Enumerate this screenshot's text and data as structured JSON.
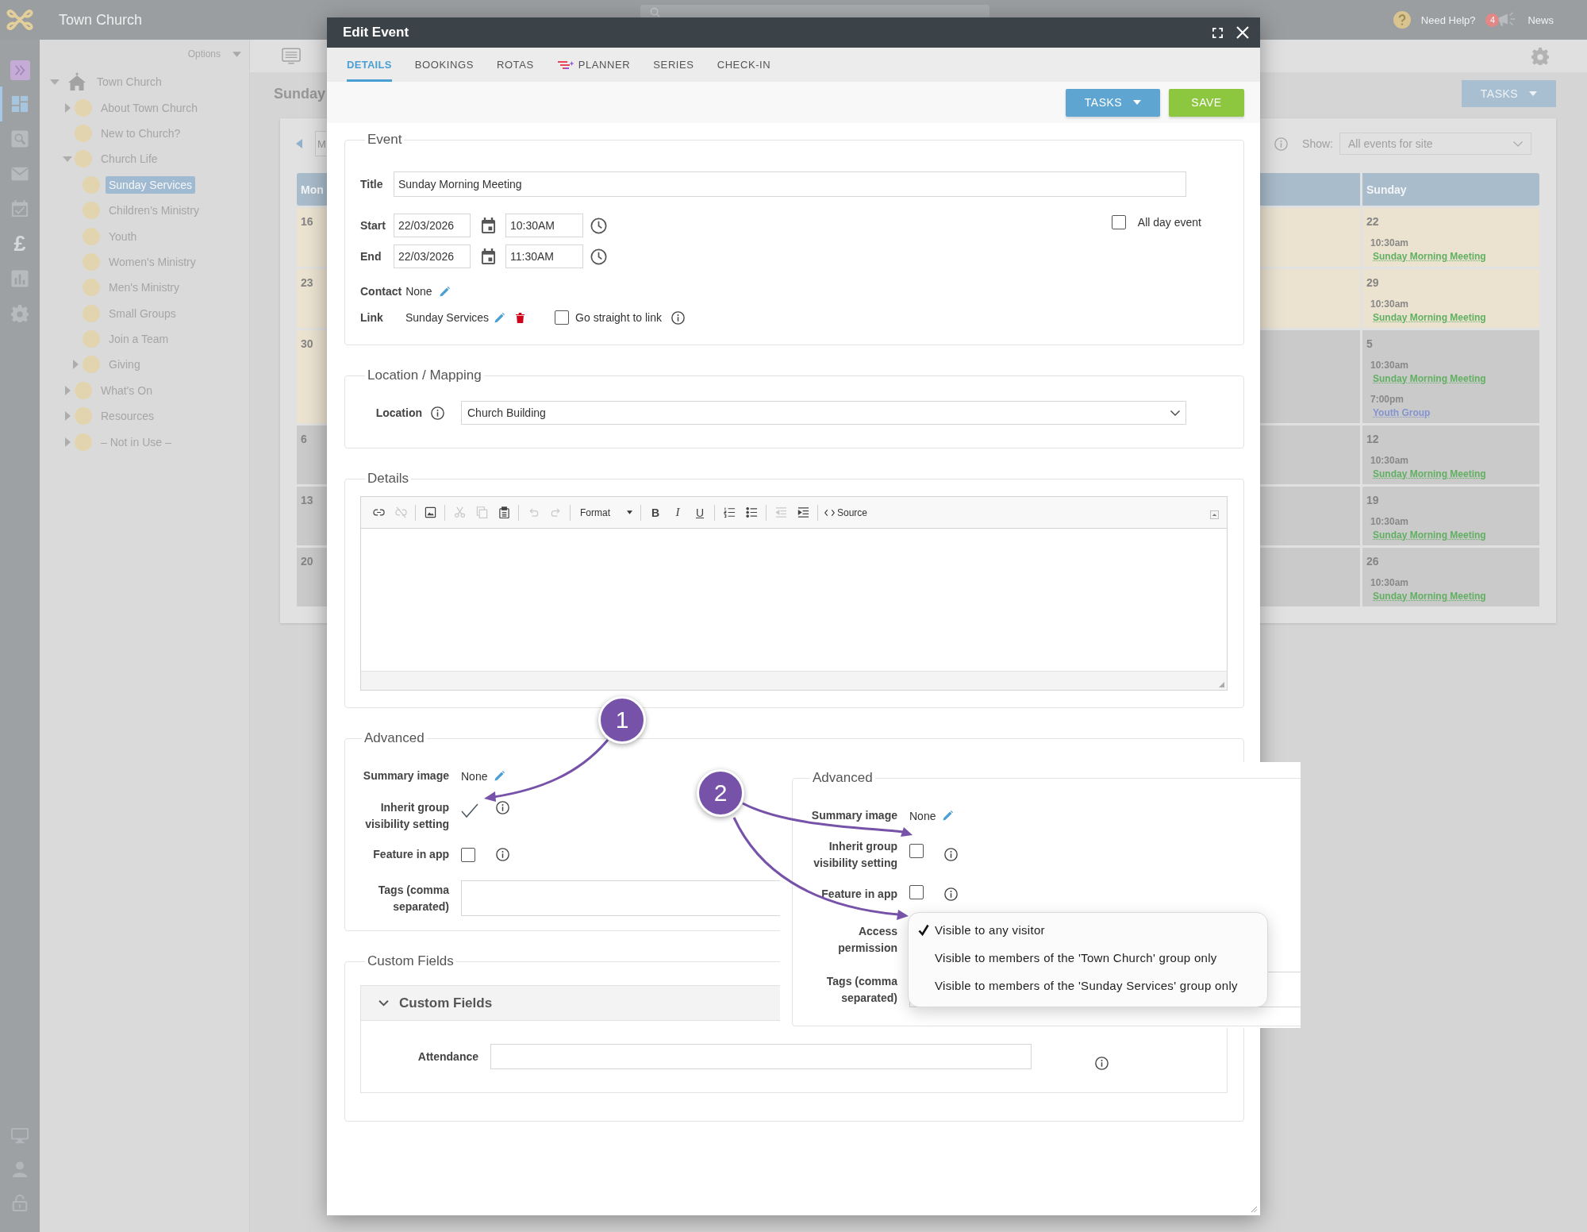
{
  "app_bar": {
    "site_name": "Town Church",
    "help_label": "Need Help?",
    "news_count": "4",
    "news_label": "News"
  },
  "nav_rail": {
    "items": [
      {
        "selected": true
      },
      {
        "selected": false
      },
      {
        "selected": false
      },
      {
        "selected": false
      },
      {
        "selected": false,
        "label": "£"
      },
      {
        "selected": false
      },
      {
        "selected": false
      }
    ]
  },
  "tree": {
    "options_label": "Options",
    "items": [
      {
        "label": "Town Church",
        "kind": "site",
        "expanded": true,
        "selected": false,
        "children": [
          {
            "label": "About Town Church",
            "kind": "page",
            "expanded": false,
            "selected": false
          },
          {
            "label": "New to Church?",
            "kind": "page",
            "selected": false
          },
          {
            "label": "Church Life",
            "kind": "page",
            "expanded": true,
            "selected": false,
            "children": [
              {
                "label": "Sunday Services",
                "kind": "page",
                "selected": true
              },
              {
                "label": "Children's Ministry",
                "kind": "page",
                "selected": false
              },
              {
                "label": "Youth",
                "kind": "page",
                "selected": false
              },
              {
                "label": "Women's Ministry",
                "kind": "page",
                "selected": false
              },
              {
                "label": "Men's Ministry",
                "kind": "page",
                "selected": false
              },
              {
                "label": "Small Groups",
                "kind": "page",
                "selected": false
              },
              {
                "label": "Join a Team",
                "kind": "page",
                "selected": false
              },
              {
                "label": "Giving",
                "kind": "page",
                "expanded": false,
                "selected": false
              }
            ]
          },
          {
            "label": "What's On",
            "kind": "page",
            "expanded": false,
            "selected": false
          },
          {
            "label": "Resources",
            "kind": "page",
            "expanded": false,
            "selected": false
          },
          {
            "label": "– Not in Use –",
            "kind": "page",
            "expanded": false,
            "selected": false
          }
        ]
      }
    ]
  },
  "page": {
    "heading": "Sunday",
    "tasks_label": "TASKS"
  },
  "calendar": {
    "view_button": "M",
    "show_label": "Show:",
    "show_value": "All events for site",
    "monday_header": "Mon",
    "sunday_header": "Sunday",
    "weeks": [
      {
        "monday": {
          "date": "16",
          "in_month": true
        },
        "saturday": {
          "in_month": true
        },
        "sunday": {
          "date": "22",
          "in_month": true,
          "events": [
            {
              "time": "10:30am",
              "title": "Sunday Morning Meeting",
              "color": "#62b062"
            }
          ]
        }
      },
      {
        "monday": {
          "date": "23",
          "in_month": true
        },
        "saturday": {
          "in_month": true
        },
        "sunday": {
          "date": "29",
          "in_month": true,
          "events": [
            {
              "time": "10:30am",
              "title": "Sunday Morning Meeting",
              "color": "#62b062"
            }
          ]
        }
      },
      {
        "monday": {
          "date": "30",
          "in_month": true
        },
        "saturday": {
          "in_month": false
        },
        "sunday": {
          "date": "5",
          "in_month": false,
          "events": [
            {
              "time": "10:30am",
              "title": "Sunday Morning Meeting",
              "color": "#62b062"
            },
            {
              "time": "7:00pm",
              "title": "Youth Group",
              "color": "#8494cf"
            }
          ]
        }
      },
      {
        "monday": {
          "date": "6",
          "in_month": false
        },
        "saturday": {
          "in_month": false
        },
        "sunday": {
          "date": "12",
          "in_month": false,
          "events": [
            {
              "time": "10:30am",
              "title": "Sunday Morning Meeting",
              "color": "#62b062"
            }
          ]
        }
      },
      {
        "monday": {
          "date": "13",
          "in_month": false
        },
        "saturday": {
          "in_month": false
        },
        "sunday": {
          "date": "19",
          "in_month": false,
          "events": [
            {
              "time": "10:30am",
              "title": "Sunday Morning Meeting",
              "color": "#62b062"
            }
          ]
        }
      },
      {
        "monday": {
          "date": "20",
          "in_month": false
        },
        "saturday": {
          "in_month": false
        },
        "sunday": {
          "date": "26",
          "in_month": false,
          "events": [
            {
              "time": "10:30am",
              "title": "Sunday Morning Meeting",
              "color": "#62b062"
            }
          ]
        }
      }
    ]
  },
  "modal": {
    "title": "Edit Event",
    "tabs": [
      {
        "label": "DETAILS",
        "kind": "plain",
        "selected": true
      },
      {
        "label": "BOOKINGS",
        "kind": "plain",
        "selected": false
      },
      {
        "label": "ROTAS",
        "kind": "plain",
        "selected": false
      },
      {
        "label": "PLANNER",
        "kind": "iconic",
        "selected": false
      },
      {
        "label": "SERIES",
        "kind": "plain",
        "selected": false
      },
      {
        "label": "CHECK-IN",
        "kind": "plain",
        "selected": false
      }
    ],
    "toolbar": {
      "tasks_label": "TASKS",
      "save_label": "SAVE"
    },
    "event": {
      "legend": "Event",
      "title_label": "Title",
      "title_value": "Sunday Morning Meeting",
      "start_label": "Start",
      "start_date": "22/03/2026",
      "start_time": "10:30AM",
      "end_label": "End",
      "end_date": "22/03/2026",
      "end_time": "11:30AM",
      "all_day_label": "All day event",
      "all_day": false,
      "contact_label": "Contact",
      "contact_value": "None",
      "link_label": "Link",
      "link_value": "Sunday Services",
      "go_straight_label": "Go straight to link",
      "go_straight": false
    },
    "location": {
      "legend": "Location / Mapping",
      "label": "Location",
      "value": "Church Building"
    },
    "details": {
      "legend": "Details",
      "toolbar": [
        {
          "kind": "icon",
          "disabled": false
        },
        {
          "kind": "icon",
          "disabled": true
        },
        {
          "kind": "icon",
          "disabled": false
        },
        {
          "kind": "icon",
          "disabled": true
        },
        {
          "kind": "icon",
          "disabled": true
        },
        {
          "kind": "icon",
          "disabled": false
        },
        {
          "kind": "icon",
          "disabled": true
        },
        {
          "kind": "icon",
          "disabled": true
        },
        {
          "kind": "dropdown",
          "label": "Format"
        },
        {
          "kind": "letter",
          "label": "B",
          "disabled": false
        },
        {
          "kind": "letter",
          "label": "I",
          "disabled": false
        },
        {
          "kind": "letter",
          "label": "U",
          "disabled": false
        },
        {
          "kind": "icon",
          "disabled": false
        },
        {
          "kind": "icon",
          "disabled": false
        },
        {
          "kind": "icon",
          "disabled": true
        },
        {
          "kind": "icon",
          "disabled": false
        },
        {
          "kind": "source",
          "label": "Source"
        }
      ]
    },
    "advanced": {
      "legend": "Advanced",
      "summary_label": "Summary image",
      "summary_value": "None",
      "inherit_label": "Inherit group visibility setting",
      "inherit": true,
      "feature_label": "Feature in app",
      "feature": false,
      "tags_label": "Tags (comma separated)"
    },
    "custom_fields": {
      "legend": "Custom Fields",
      "panel_title": "Custom Fields",
      "expanded": true,
      "attendance_label": "Attendance"
    }
  },
  "inset": {
    "legend": "Advanced",
    "summary_label": "Summary image",
    "summary_value": "None",
    "inherit_label": "Inherit group visibility setting",
    "inherit": false,
    "feature_label": "Feature in app",
    "feature": false,
    "access_label": "Access permission",
    "tags_label": "Tags (comma separated)",
    "options": [
      {
        "label": "Visible to any visitor",
        "selected": true
      },
      {
        "label": "Visible to members of the 'Town Church' group only",
        "selected": false
      },
      {
        "label": "Visible to members of the 'Sunday Services' group only",
        "selected": false
      }
    ]
  },
  "callouts": [
    {
      "number": "1"
    },
    {
      "number": "2"
    }
  ]
}
